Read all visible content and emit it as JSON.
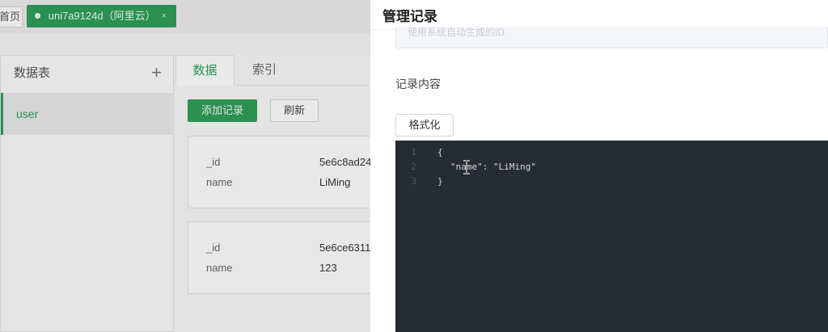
{
  "tabbar": {
    "home_label": "首页",
    "space_label": "uni7a9124d（阿里云）",
    "close_label": "×"
  },
  "tables_panel": {
    "title": "数据表",
    "add_label": "+",
    "items": [
      {
        "label": "user"
      }
    ]
  },
  "main": {
    "tabs": [
      {
        "label": "数据"
      },
      {
        "label": "索引"
      }
    ],
    "add_record_label": "添加记录",
    "refresh_label": "刷新",
    "records": [
      {
        "rows": [
          {
            "key": "_id",
            "value": "5e6c8ad24"
          },
          {
            "key": "name",
            "value": "LiMing"
          }
        ]
      },
      {
        "rows": [
          {
            "key": "_id",
            "value": "5e6ce6311"
          },
          {
            "key": "name",
            "value": "123"
          }
        ]
      }
    ]
  },
  "drawer": {
    "title": "管理记录",
    "id_placeholder": "使用系统自动生成的ID",
    "content_label": "记录内容",
    "format_label": "格式化",
    "editor": {
      "line_numbers": [
        "1",
        "2",
        "3"
      ],
      "lines": [
        "{",
        "\"name\": \"LiMing\"",
        "}"
      ]
    }
  },
  "colors": {
    "accent": "#2f9a57",
    "editor_bg": "#272b33"
  }
}
